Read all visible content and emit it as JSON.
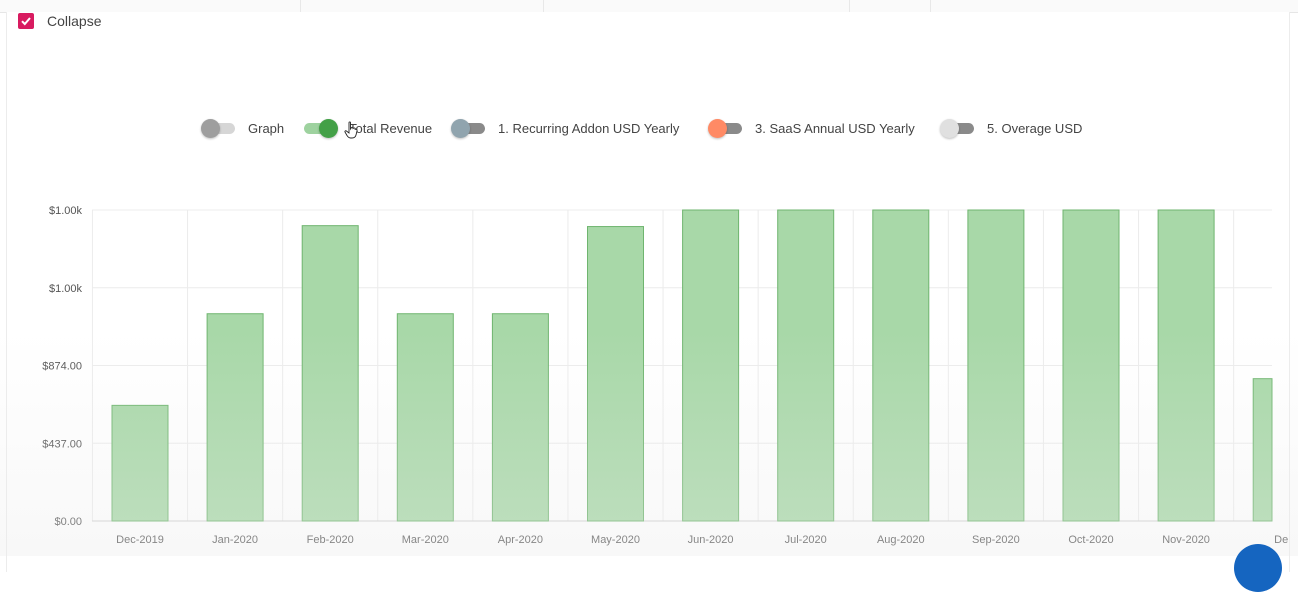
{
  "collapse": {
    "label": "Collapse",
    "checked": true
  },
  "legend": [
    {
      "label": "Graph",
      "on": false,
      "knob": "#9e9e9e",
      "track": "#d6d6d6"
    },
    {
      "label": "Total Revenue",
      "on": true,
      "knob": "#43a047",
      "track": "#9ed29f"
    },
    {
      "label": "1. Recurring Addon USD Yearly",
      "on": false,
      "knob": "#90a4ae",
      "track": "#8a8a8a"
    },
    {
      "label": "3. SaaS Annual USD Yearly",
      "on": false,
      "knob": "#ff8a65",
      "track": "#8a8a8a"
    },
    {
      "label": "5. Overage USD",
      "on": false,
      "knob": "#e0e0e0",
      "track": "#8a8a8a"
    }
  ],
  "colors": {
    "bar_fill": "#a8d8a8",
    "bar_stroke": "#6fb56f",
    "grid": "#ececec",
    "checkbox": "#d81b60"
  },
  "chart_data": {
    "type": "bar",
    "categories": [
      "Dec-2019",
      "Jan-2020",
      "Feb-2020",
      "Mar-2020",
      "Apr-2020",
      "May-2020",
      "Jun-2020",
      "Jul-2020",
      "Aug-2020",
      "Sep-2020",
      "Oct-2020",
      "Nov-2020",
      "De"
    ],
    "series": [
      {
        "name": "Total Revenue",
        "values": [
          650,
          1165,
          1660,
          1165,
          1165,
          1655,
          1748,
          1748,
          1748,
          1748,
          1748,
          1748,
          800
        ]
      }
    ],
    "y_ticks": [
      {
        "value": 0,
        "label": "$0.00"
      },
      {
        "value": 437,
        "label": "$437.00"
      },
      {
        "value": 874,
        "label": "$874.00"
      },
      {
        "value": 1311,
        "label": "$1.00k"
      },
      {
        "value": 1748,
        "label": "$1.00k"
      }
    ],
    "ylim": [
      0,
      1748
    ],
    "title": "",
    "xlabel": "",
    "ylabel": "",
    "grid": true,
    "legend": "top-center"
  }
}
